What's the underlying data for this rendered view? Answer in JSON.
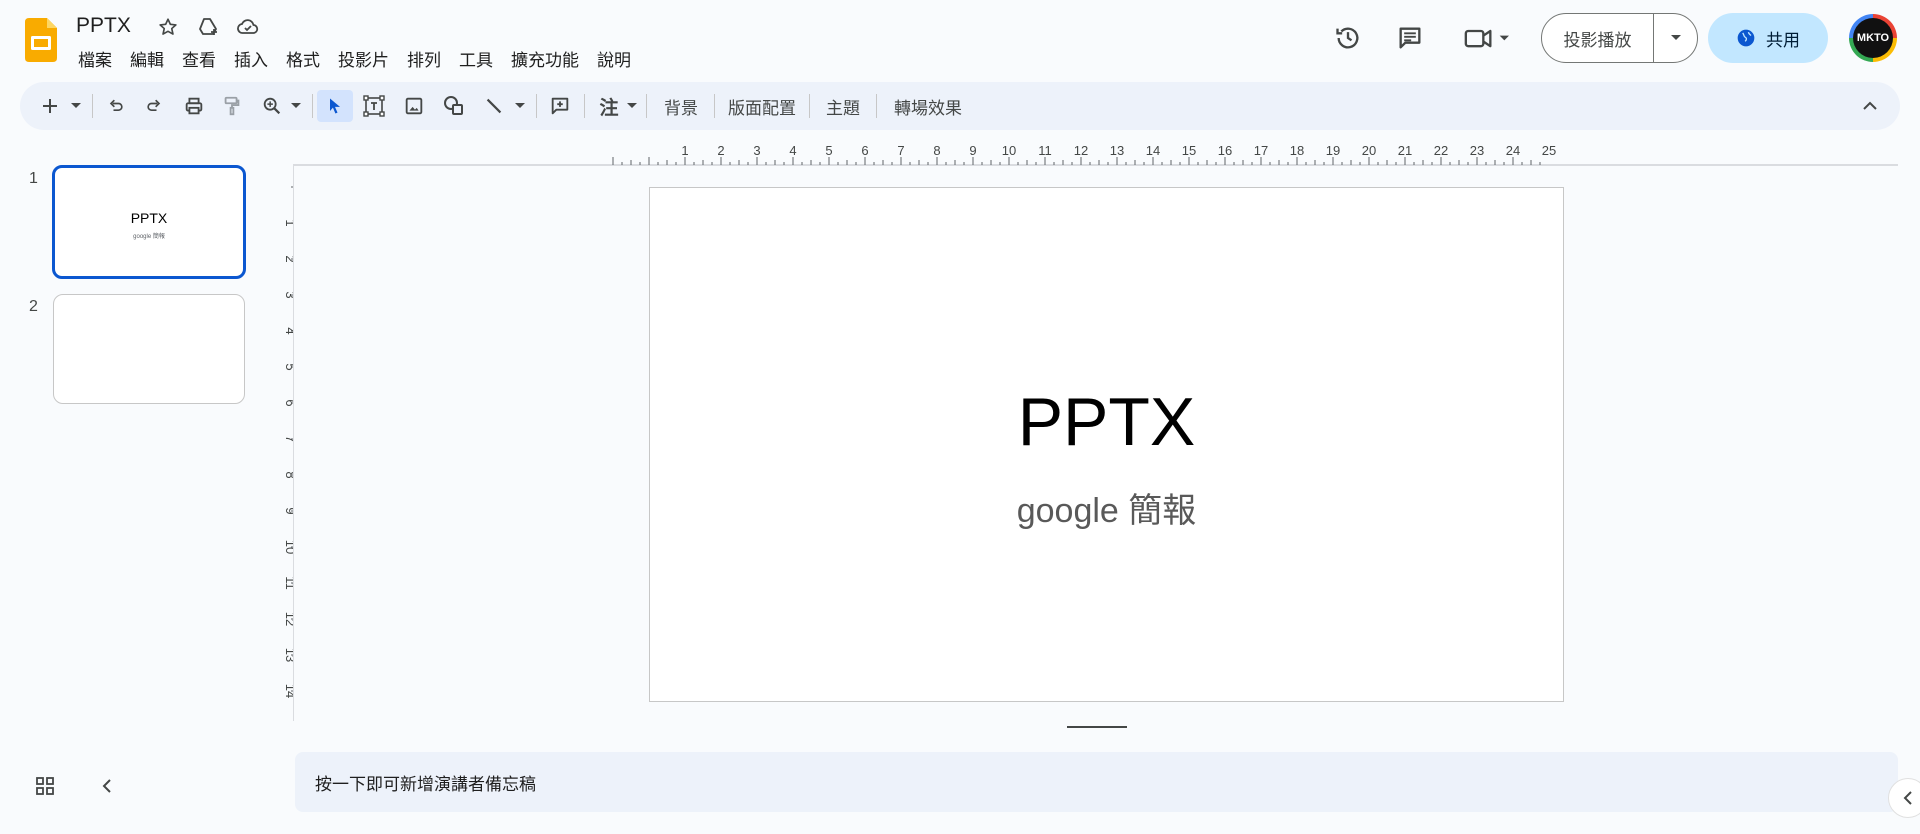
{
  "app": {
    "title": "PPTX",
    "menu": [
      "檔案",
      "編輯",
      "查看",
      "插入",
      "格式",
      "投影片",
      "排列",
      "工具",
      "擴充功能",
      "說明"
    ]
  },
  "header": {
    "present_label": "投影播放",
    "share_label": "共用",
    "avatar_text": "MKTO"
  },
  "toolbar": {
    "background_label": "背景",
    "layout_label": "版面配置",
    "theme_label": "主題",
    "transition_label": "轉場效果",
    "notes_icon_label": "注"
  },
  "filmstrip": {
    "slides": [
      {
        "number": "1",
        "title": "PPTX",
        "subtitle": "google 簡報"
      },
      {
        "number": "2",
        "title": "",
        "subtitle": ""
      }
    ]
  },
  "slide": {
    "title": "PPTX",
    "subtitle": "google 簡報"
  },
  "rulers": {
    "horizontal": [
      "1",
      "2",
      "3",
      "4",
      "5",
      "6",
      "7",
      "8",
      "9",
      "10",
      "11",
      "12",
      "13",
      "14",
      "15",
      "16",
      "17",
      "18",
      "19",
      "20",
      "21",
      "22",
      "23",
      "24",
      "25"
    ],
    "vertical": [
      "1",
      "2",
      "3",
      "4",
      "5",
      "6",
      "7",
      "8",
      "9",
      "10",
      "11",
      "12",
      "13",
      "14"
    ]
  },
  "notes": {
    "placeholder": "按一下即可新增演講者備忘稿"
  },
  "colors": {
    "accent": "#0b57d0",
    "share_bg": "#c2e7ff",
    "toolbar_bg": "#edf2fa",
    "slides_logo": "#f9ab00"
  }
}
